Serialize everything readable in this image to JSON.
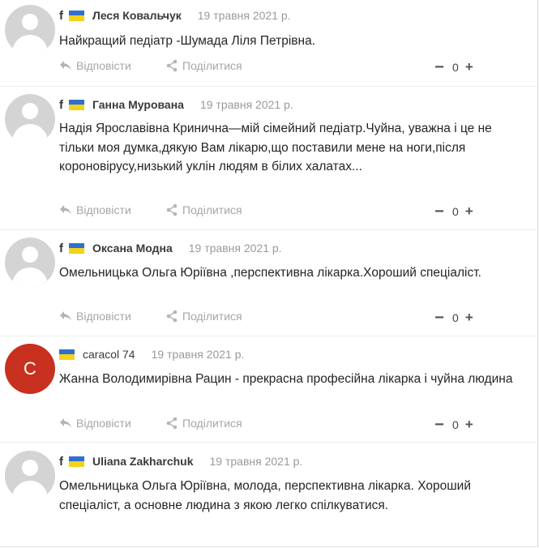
{
  "labels": {
    "reply": "Відповісти",
    "share": "Поділитися",
    "facebook_mark": "f"
  },
  "colors": {
    "flag_blue": "#2f6fd0",
    "flag_yellow": "#f5d21a",
    "avatar_letter_bg": "#c8301f",
    "avatar_default_bg": "#d4d4d4"
  },
  "comments": [
    {
      "author": "Леся Ковальчук",
      "date": "19 травня 2021 р.",
      "text": "Найкращий педіатр  -Шумада Ліля Петрівна.",
      "votes": "0",
      "facebook": true
    },
    {
      "author": "Ганна Мурована",
      "date": "19 травня 2021 р.",
      "text": "Надія Ярославівна Кринична—мій сімейний педіатр.Чуйна, уважна і це не тільки моя думка,дякую Вам лікарю,що поставили мене на ноги,після короновірусу,низький уклін людям в білих халатах...",
      "votes": "0",
      "facebook": true
    },
    {
      "author": "Оксана Модна",
      "date": "19 травня 2021 р.",
      "text": "Омельницька Ольга Юріївна ,перспективна лікарка.Хороший спеціаліст.",
      "votes": "0",
      "facebook": true
    },
    {
      "author": "caracol 74",
      "date": "19 травня 2021 р.",
      "text": "Жанна Володимирівна Рацин - прекрасна професійна лікарка і чуйна людина",
      "votes": "0",
      "facebook": false,
      "avatar_letter": "C"
    },
    {
      "author": "Uliana Zakharchuk",
      "date": "19 травня 2021 р.",
      "text": "Омельницька Ольга Юріївна, молода, перспективна лікарка. Хороший спеціаліст, а основне людина з якою легко спілкуватися.",
      "votes": null,
      "facebook": true
    }
  ]
}
